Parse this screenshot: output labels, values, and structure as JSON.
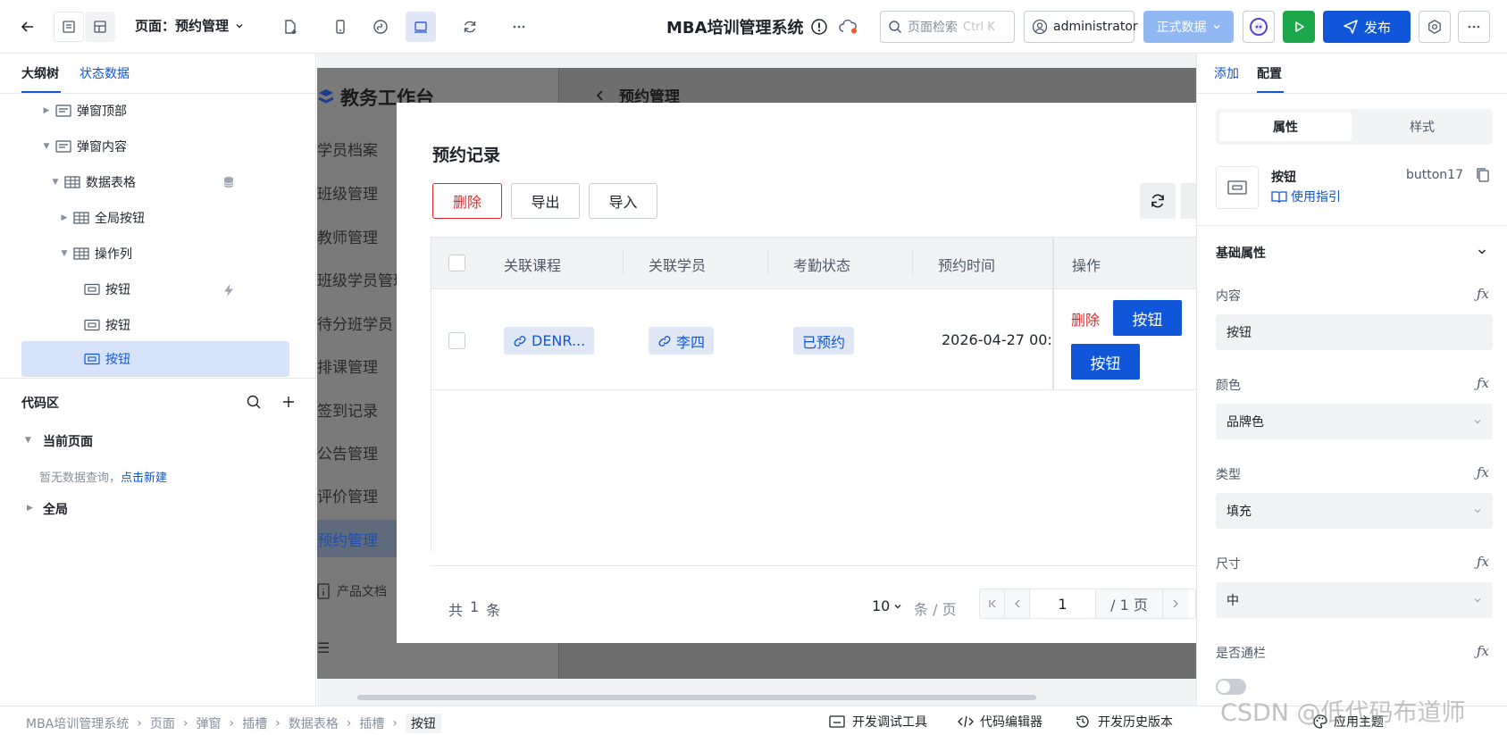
{
  "topbar": {
    "page_label": "页面：预约管理",
    "app_title": "MBA培训管理系统",
    "search_placeholder": "页面检索",
    "search_shortcut": "Ctrl K",
    "user": "administrator",
    "env": "正式数据",
    "publish": "发布",
    "colors": {
      "accent": "#0f56d9",
      "green": "#1aa84a",
      "env": "#91b8f2"
    }
  },
  "left_panel": {
    "tabs": [
      "大纲树",
      "状态数据"
    ],
    "tree": [
      {
        "label": "弹窗顶部"
      },
      {
        "label": "弹窗内容"
      },
      {
        "label": "数据表格"
      },
      {
        "label": "全局按钮"
      },
      {
        "label": "操作列"
      },
      {
        "label": "按钮"
      },
      {
        "label": "按钮"
      },
      {
        "label": "按钮"
      }
    ],
    "code_area": {
      "title": "代码区",
      "current_page": "当前页面",
      "empty_text": "暂无数据查询，",
      "create_link": "点击新建",
      "global": "全局"
    }
  },
  "canvas": {
    "workspace_title": "教务工作台",
    "header_title": "预约管理",
    "nav": [
      "学员档案",
      "班级管理",
      "教师管理",
      "班级学员管理",
      "待分班学员",
      "排课管理",
      "签到记录",
      "公告管理",
      "评价管理",
      "预约管理"
    ],
    "product_docs": "产品文档",
    "modal": {
      "title": "预约记录",
      "actions": {
        "delete": "删除",
        "export": "导出",
        "import": "导入"
      },
      "columns": [
        "关联课程",
        "关联学员",
        "考勤状态",
        "预约时间",
        "操作"
      ],
      "row": {
        "course": "DENR...",
        "student": "李四",
        "status": "已预约",
        "time": "2026-04-27 00:0",
        "op_delete": "删除",
        "op_button_1": "按钮",
        "op_button_2": "按钮"
      },
      "pagination": {
        "total_prefix": "共",
        "total": "1",
        "total_suffix": "条",
        "page_size": "10",
        "per_page": "条 / 页",
        "current_page": "1",
        "total_pages": "/ 1 页"
      }
    }
  },
  "right_panel": {
    "tabs": [
      "添加",
      "配置"
    ],
    "seg": [
      "属性",
      "样式"
    ],
    "component_name": "按钮",
    "component_id": "button17",
    "guide": "使用指引",
    "section": "基础属性",
    "fields": [
      {
        "label": "内容",
        "value": "按钮"
      },
      {
        "label": "颜色",
        "value": "品牌色"
      },
      {
        "label": "类型",
        "value": "填充"
      },
      {
        "label": "尺寸",
        "value": "中"
      },
      {
        "label": "是否通栏",
        "value": ""
      }
    ]
  },
  "statusbar": {
    "breadcrumbs": [
      "MBA培训管理系统",
      "页面",
      "弹窗",
      "插槽",
      "数据表格",
      "插槽",
      "按钮"
    ],
    "dev_tools": "开发调试工具",
    "code_editor": "代码编辑器",
    "history": "开发历史版本",
    "theme": "应用主题"
  },
  "watermark": "CSDN @低代码布道师"
}
